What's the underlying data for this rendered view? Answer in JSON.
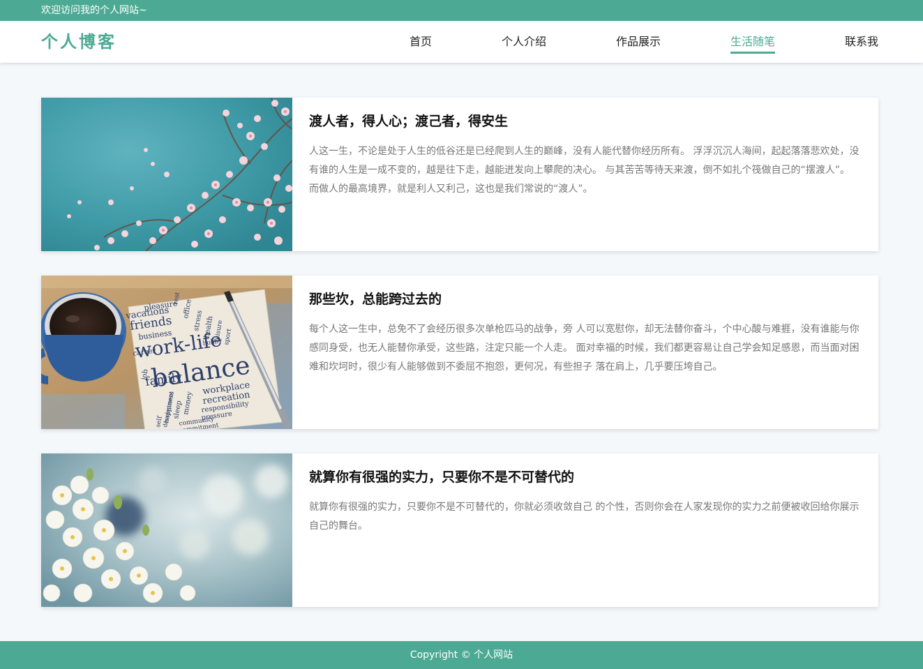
{
  "topbar": {
    "welcome": "欢迎访问我的个人网站~"
  },
  "header": {
    "logo": "个人博客",
    "nav": [
      {
        "label": "首页",
        "active": false
      },
      {
        "label": "个人介绍",
        "active": false
      },
      {
        "label": "作品展示",
        "active": false
      },
      {
        "label": "生活随笔",
        "active": true
      },
      {
        "label": "联系我",
        "active": false
      }
    ]
  },
  "articles": [
    {
      "title": "渡人者，得人心；渡己者，得安生",
      "text": "人这一生，不论是处于人生的低谷还是已经爬到人生的巅峰，没有人能代替你经历所有。 浮浮沉沉人海间，起起落落悲欢处，没有谁的人生是一成不变的，越是往下走，越能迸发向上攀爬的决心。 与其苦苦等待天来渡，倒不如扎个筏做自己的“摆渡人”。 而做人的最高境界，就是利人又利己，这也是我们常说的“渡人”。",
      "image": "cherry-blossom-on-teal-sky-photo"
    },
    {
      "title": "那些坎，总能跨过去的",
      "text": "每个人这一生中，总免不了会经历很多次单枪匹马的战争，旁 人可以宽慰你，却无法替你奋斗，个中心酸与难捱，没有谁能与你 感同身受，也无人能替你承受，这些路，注定只能一个人走。 面对幸福的时候，我们都更容易让自己学会知足感恩，而当面对困 难和坎坷时，很少有人能够做到不委屈不抱怨，更何况，有些担子 落在肩上，几乎要压垮自己。",
      "image": "coffee-cup-and-work-life-balance-napkin-photo",
      "napkin_words": {
        "big": [
          "work-life",
          "balance"
        ],
        "medium": [
          "friends",
          "family",
          "vacations",
          "business",
          "career",
          "workplace",
          "recreation"
        ],
        "small": [
          "pleasure",
          "rest",
          "office",
          "stress",
          "health",
          "leisure",
          "sport",
          "hobby",
          "job",
          "money",
          "sleep",
          "happiness",
          "responsibility",
          "pressure",
          "community",
          "commitment",
          "education",
          "self",
          "development"
        ]
      }
    },
    {
      "title": "就算你有很强的实力，只要你不是不可替代的",
      "text": "就算你有很强的实力，只要你不是不可替代的，你就必须收敛自己 的个性，否则你会在人家发现你的实力之前便被收回给你展示自己的舞台。",
      "image": "white-blossom-blurred-background-photo"
    }
  ],
  "footer": {
    "copyright": "Copyright © 个人网站"
  },
  "colors": {
    "accent": "#4caa94",
    "page_bg": "#f4f8fb"
  }
}
